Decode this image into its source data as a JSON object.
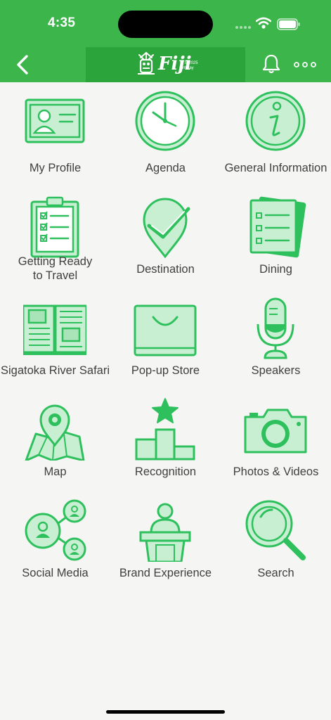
{
  "status_bar": {
    "time": "4:35"
  },
  "header": {
    "logo_word": "Fiji",
    "logo_sub_1": "LTS 2025",
    "logo_sub_2": "Amway"
  },
  "colors": {
    "brand": "#3cb54b",
    "icon_stroke": "#2ec05c",
    "icon_fill": "#c9efd3"
  },
  "menu": {
    "items": [
      {
        "label": "My Profile",
        "icon": "profile-card-icon"
      },
      {
        "label": "Agenda",
        "icon": "clock-icon"
      },
      {
        "label": "General Information",
        "icon": "info-icon"
      },
      {
        "label": "Getting Ready",
        "label_line2": "to Travel",
        "icon": "clipboard-checklist-icon"
      },
      {
        "label": "Destination",
        "icon": "location-check-icon"
      },
      {
        "label": "Dining",
        "icon": "menu-card-icon"
      },
      {
        "label": "Sigatoka River Safari",
        "icon": "open-book-icon"
      },
      {
        "label": "Pop-up Store",
        "icon": "shopping-bag-icon"
      },
      {
        "label": "Speakers",
        "icon": "microphone-icon"
      },
      {
        "label": "Map",
        "icon": "map-pin-icon"
      },
      {
        "label": "Recognition",
        "icon": "podium-star-icon"
      },
      {
        "label": "Photos & Videos",
        "icon": "camera-icon"
      },
      {
        "label": "Social Media",
        "icon": "social-network-icon"
      },
      {
        "label": "Brand Experience",
        "icon": "speaker-podium-icon"
      },
      {
        "label": "Search",
        "icon": "magnifier-icon"
      }
    ]
  }
}
